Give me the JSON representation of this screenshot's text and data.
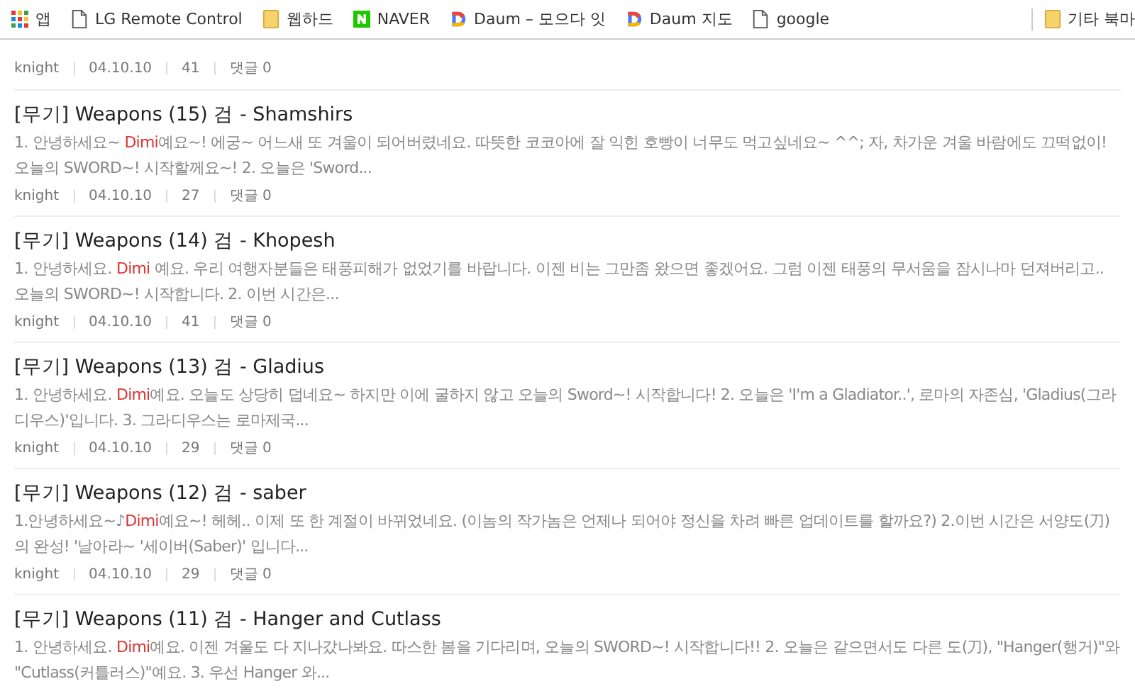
{
  "bookmarks_bar": {
    "items": [
      {
        "kind": "apps",
        "label": "앱"
      },
      {
        "kind": "page",
        "label": "LG Remote Control"
      },
      {
        "kind": "folder",
        "label": "웹하드"
      },
      {
        "kind": "naver",
        "label": "NAVER"
      },
      {
        "kind": "daum",
        "label": "Daum – 모으다 잇"
      },
      {
        "kind": "daum",
        "label": "Daum 지도"
      },
      {
        "kind": "page",
        "label": "google"
      }
    ],
    "other": {
      "kind": "folder",
      "label": "기타 북마"
    }
  },
  "posts": [
    {
      "meta": {
        "author": "knight",
        "date": "04.10.10",
        "views": "41",
        "comments": "댓글 0"
      }
    },
    {
      "title": "[무기] Weapons (15) 검 - Shamshirs",
      "snippet_before": "1. 안녕하세요~ ",
      "highlight": "Dimi",
      "snippet_after": "예요~! 에궁~ 어느새 또 겨울이 되어버렸네요. 따뜻한 코코아에 잘 익힌 호빵이 너무도 먹고싶네요~ ^^; 자, 차가운 겨울 바람에도 끄떡없이! 오늘의 SWORD~! 시작할께요~! 2. 오늘은 'Sword...",
      "meta": {
        "author": "knight",
        "date": "04.10.10",
        "views": "27",
        "comments": "댓글 0"
      }
    },
    {
      "title": "[무기] Weapons (14) 검 - Khopesh",
      "snippet_before": "1. 안녕하세요. ",
      "highlight": "Dimi",
      "snippet_after": " 예요. 우리 여행자분들은 태풍피해가 없었기를 바랍니다. 이젠 비는 그만좀 왔으면 좋겠어요. 그럼 이젠 태풍의 무서움을 잠시나마 던져버리고.. 오늘의 SWORD~! 시작합니다. 2. 이번 시간은...",
      "meta": {
        "author": "knight",
        "date": "04.10.10",
        "views": "41",
        "comments": "댓글 0"
      }
    },
    {
      "title": "[무기] Weapons (13) 검 - Gladius",
      "snippet_before": "1. 안녕하세요. ",
      "highlight": "Dimi",
      "snippet_after": "예요. 오늘도 상당히 덥네요~ 하지만 이에 굴하지 않고 오늘의 Sword~! 시작합니다! 2. 오늘은 'I'm a Gladiator..', 로마의 자존심, 'Gladius(그라디우스)'입니다. 3. 그라디우스는 로마제국...",
      "meta": {
        "author": "knight",
        "date": "04.10.10",
        "views": "29",
        "comments": "댓글 0"
      }
    },
    {
      "title": "[무기] Weapons (12) 검 - saber",
      "snippet_before": "1.안녕하세요~♪",
      "highlight": "Dimi",
      "snippet_after": "예요~! 헤헤.. 이제 또 한 계절이 바뀌었네요. (이놈의 작가놈은 언제나 되어야 정신을 차려 빠른 업데이트를 할까요?) 2.이번 시간은 서양도(刀)의 완성! '날아라~ '세이버(Saber)' 입니다...",
      "meta": {
        "author": "knight",
        "date": "04.10.10",
        "views": "29",
        "comments": "댓글 0"
      }
    },
    {
      "title": "[무기] Weapons (11) 검 - Hanger and Cutlass",
      "snippet_before": "1. 안녕하세요. ",
      "highlight": "Dimi",
      "snippet_after": "예요. 이젠 겨울도 다 지나갔나봐요. 따스한 봄을 기다리며, 오늘의 SWORD~! 시작합니다!! 2. 오늘은 같으면서도 다른 도(刀), \"Hanger(행거)\"와 \"Cutlass(커틀러스)\"예요. 3. 우선 Hanger 와..."
    }
  ]
}
